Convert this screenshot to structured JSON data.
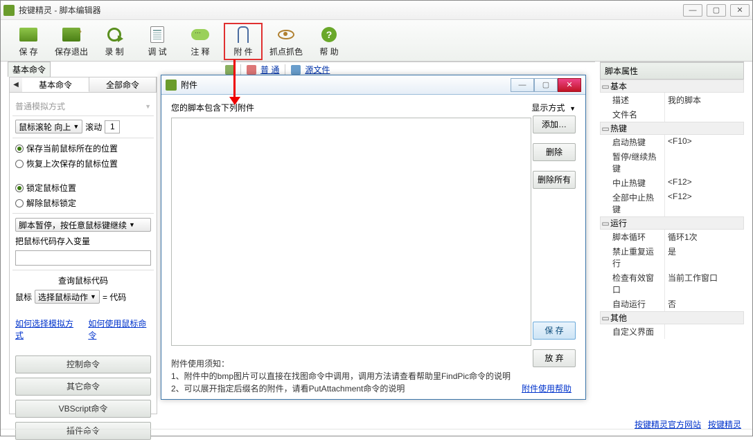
{
  "main": {
    "title": "按键精灵 - 脚本编辑器",
    "window_controls": {
      "minimize": "—",
      "maximize": "▢",
      "close": "✕"
    },
    "toolbar": [
      {
        "id": "save",
        "label": "保 存"
      },
      {
        "id": "save-exit",
        "label": "保存退出"
      },
      {
        "id": "record",
        "label": "录 制"
      },
      {
        "id": "debug",
        "label": "调 试"
      },
      {
        "id": "comment",
        "label": "注 释"
      },
      {
        "id": "attachment",
        "label": "附 件"
      },
      {
        "id": "color-picker",
        "label": "抓点抓色"
      },
      {
        "id": "help",
        "label": "帮 助"
      }
    ],
    "center_tabs": {
      "normal": "普 通",
      "source": "源文件"
    }
  },
  "left": {
    "section_label": "基本命令",
    "tabs": {
      "basic": "基本命令",
      "all": "全部命令"
    },
    "sim_mode": "普通模拟方式",
    "mouse_wheel": {
      "label": "鼠标滚轮",
      "dir": "向上",
      "action": "滚动",
      "count": "1"
    },
    "radios": {
      "save_pos": "保存当前鼠标所在的位置",
      "restore_pos": "恢复上次保存的鼠标位置",
      "lock": "锁定鼠标位置",
      "unlock": "解除鼠标锁定"
    },
    "pause_dropdown": "脚本暂停，按任意鼠标键继续",
    "var_label": "把鼠标代码存入变量",
    "var_value": "",
    "query_label": "查询鼠标代码",
    "mouse_label": "鼠标",
    "action_dd": "选择鼠标动作",
    "eq": "= 代码",
    "links": {
      "choose_sim": "如何选择模拟方式",
      "how_use": "如何使用鼠标命令"
    },
    "categories": {
      "control": "控制命令",
      "other": "其它命令",
      "vbs": "VBScript命令",
      "plugin": "插件命令"
    }
  },
  "right": {
    "title": "脚本属性",
    "groups": {
      "basic": {
        "label": "基本",
        "rows": {
          "desc": {
            "k": "描述",
            "v": "我的脚本"
          },
          "file": {
            "k": "文件名",
            "v": ""
          }
        }
      },
      "hotkey": {
        "label": "热键",
        "rows": {
          "start": {
            "k": "启动热键",
            "v": "<F10>"
          },
          "pause": {
            "k": "暂停/继续热键",
            "v": ""
          },
          "stop": {
            "k": "中止热键",
            "v": "<F12>"
          },
          "stopall": {
            "k": "全部中止热键",
            "v": "<F12>"
          }
        }
      },
      "run": {
        "label": "运行",
        "rows": {
          "loop": {
            "k": "脚本循环",
            "v": "循环1次"
          },
          "noredo": {
            "k": "禁止重复运行",
            "v": "是"
          },
          "chkwin": {
            "k": "检查有效窗口",
            "v": "当前工作窗口"
          },
          "autorun": {
            "k": "自动运行",
            "v": "否"
          }
        }
      },
      "other": {
        "label": "其他",
        "rows": {
          "ui": {
            "k": "自定义界面",
            "v": ""
          }
        }
      }
    }
  },
  "dialog": {
    "title": "附件",
    "header_text": "您的脚本包含下列附件",
    "display_mode": "显示方式",
    "buttons": {
      "add": "添加…",
      "delete": "删除",
      "delete_all": "删除所有",
      "save": "保 存",
      "discard": "放 弃"
    },
    "footer_label": "附件使用须知：",
    "footer_line1": "1、附件中的bmp图片可以直接在找图命令中调用，调用方法请查看帮助里FindPic命令的说明",
    "footer_line2": "2、可以展开指定后缀名的附件，请看PutAttachment命令的说明",
    "footer_link": "附件使用帮助"
  },
  "footer_links": {
    "official": "按键精灵官方网站",
    "forum": "按键精灵"
  }
}
